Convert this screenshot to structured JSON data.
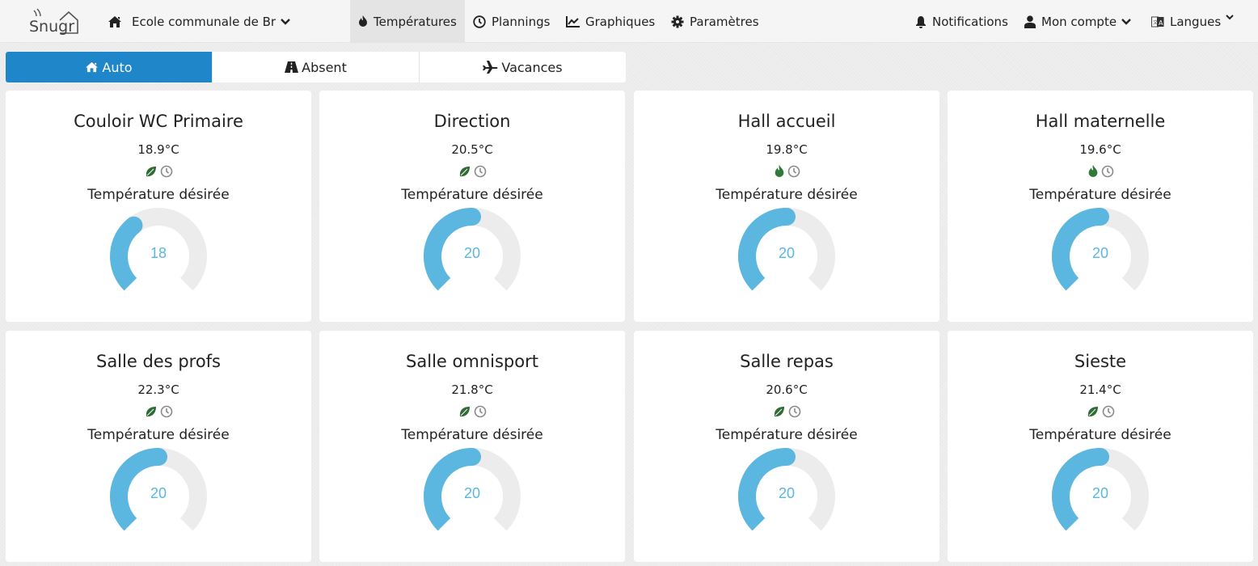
{
  "navbar": {
    "logo_text": "Snugr",
    "site_selector": {
      "label": "Ecole communale de Br",
      "icon": "home-icon"
    },
    "menu": [
      {
        "label": "Températures",
        "icon": "fire-icon",
        "active": true
      },
      {
        "label": "Plannings",
        "icon": "clock-icon",
        "active": false
      },
      {
        "label": "Graphiques",
        "icon": "chart-line-icon",
        "active": false
      },
      {
        "label": "Paramètres",
        "icon": "gear-icon",
        "active": false
      }
    ],
    "right": [
      {
        "label": "Notifications",
        "icon": "bell-icon"
      },
      {
        "label": "Mon compte",
        "icon": "user-icon"
      },
      {
        "label": "Langues",
        "icon": "language-icon"
      }
    ]
  },
  "modes": [
    {
      "label": "Auto",
      "icon": "home-icon",
      "active": true
    },
    {
      "label": "Absent",
      "icon": "road-icon",
      "active": false
    },
    {
      "label": "Vacances",
      "icon": "plane-icon",
      "active": false
    }
  ],
  "colors": {
    "accent": "#1f86c9",
    "gauge_fill": "#5bb6e0",
    "gauge_track": "#ececec",
    "eco_green": "#2e6b35",
    "heat_green": "#2f7a3a"
  },
  "gauge_range": {
    "min": 13,
    "max": 27
  },
  "desired_label": "Température désirée",
  "rooms": [
    {
      "name": "Couloir WC Primaire",
      "current": "18.9°C",
      "status_icon": "leaf-icon",
      "desired": 18
    },
    {
      "name": "Direction",
      "current": "20.5°C",
      "status_icon": "leaf-icon",
      "desired": 20
    },
    {
      "name": "Hall accueil",
      "current": "19.8°C",
      "status_icon": "fire-icon",
      "desired": 20
    },
    {
      "name": "Hall maternelle",
      "current": "19.6°C",
      "status_icon": "fire-icon",
      "desired": 20
    },
    {
      "name": "Salle des profs",
      "current": "22.3°C",
      "status_icon": "leaf-icon",
      "desired": 20
    },
    {
      "name": "Salle omnisport",
      "current": "21.8°C",
      "status_icon": "leaf-icon",
      "desired": 20
    },
    {
      "name": "Salle repas",
      "current": "20.6°C",
      "status_icon": "leaf-icon",
      "desired": 20
    },
    {
      "name": "Sieste",
      "current": "21.4°C",
      "status_icon": "leaf-icon",
      "desired": 20
    }
  ]
}
